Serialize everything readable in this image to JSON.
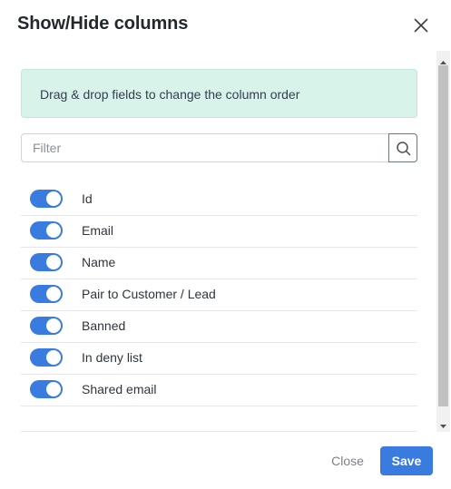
{
  "modal": {
    "title": "Show/Hide columns",
    "close_icon": "close-icon"
  },
  "info_text": "Drag & drop fields to change the column order",
  "filter": {
    "value": "",
    "placeholder": "Filter",
    "search_icon": "search-icon"
  },
  "columns": [
    {
      "label": "Id",
      "enabled": true
    },
    {
      "label": "Email",
      "enabled": true
    },
    {
      "label": "Name",
      "enabled": true
    },
    {
      "label": "Pair to Customer / Lead",
      "enabled": true
    },
    {
      "label": "Banned",
      "enabled": true
    },
    {
      "label": "In deny list",
      "enabled": true
    },
    {
      "label": "Shared email",
      "enabled": true
    }
  ],
  "footer": {
    "close_label": "Close",
    "save_label": "Save"
  },
  "colors": {
    "accent": "#3a7be0",
    "info_bg": "#d7f3ea"
  }
}
